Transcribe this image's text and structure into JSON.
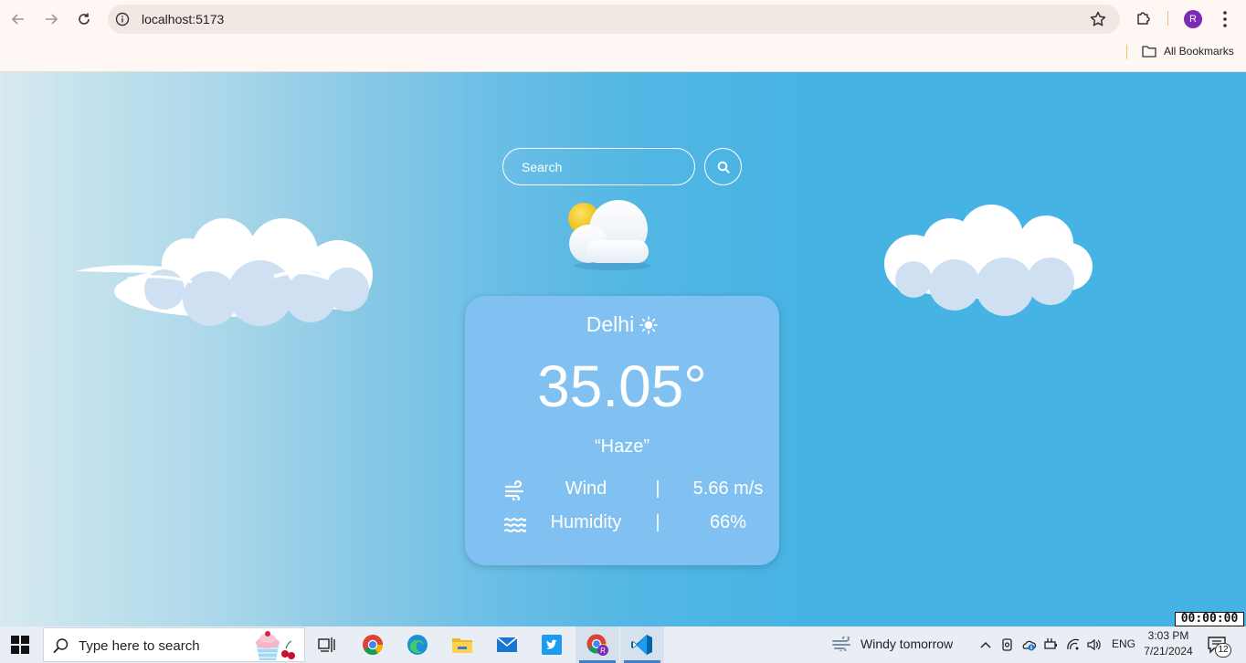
{
  "browser": {
    "url": "localhost:5173",
    "profile_initial": "R",
    "bookmarks_label": "All Bookmarks"
  },
  "app": {
    "search_placeholder": "Search",
    "city": "Delhi",
    "temperature": "35.05°",
    "description": "“Haze”",
    "stats": [
      {
        "label": "Wind",
        "separator": "|",
        "value": "5.66 m/s",
        "icon": "wind-icon"
      },
      {
        "label": "Humidity",
        "separator": "|",
        "value": "66%",
        "icon": "humidity-icon"
      }
    ],
    "colors": {
      "card": "#80c1f2",
      "sky": "#44b3e3",
      "sun": "#f6c915"
    }
  },
  "overlay": {
    "timer": "00:00:00"
  },
  "taskbar": {
    "search_placeholder": "Type here to search",
    "weather_text": "Windy tomorrow",
    "language": "ENG",
    "time": "3:03 PM",
    "date": "7/21/2024",
    "notification_count": "12"
  }
}
